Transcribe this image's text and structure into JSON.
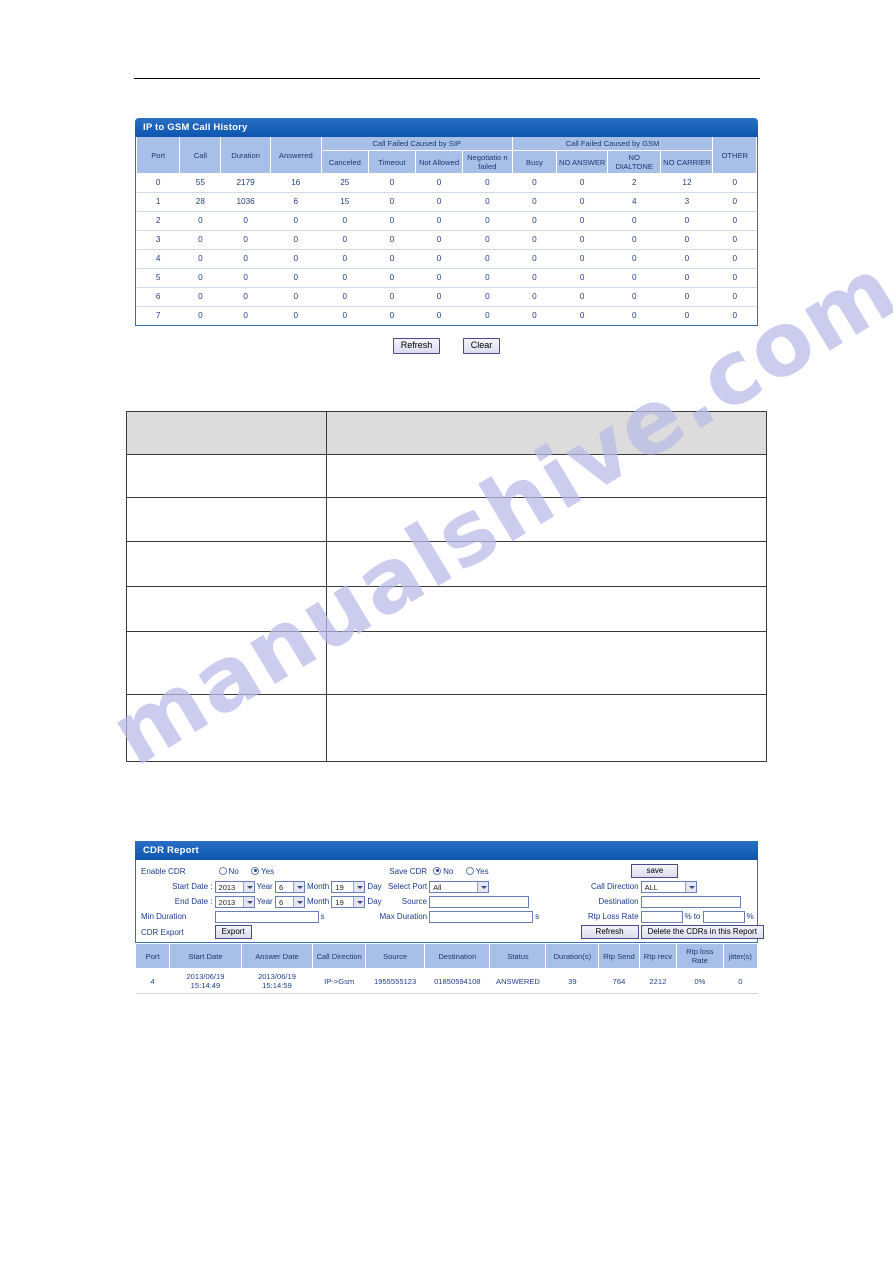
{
  "watermark": {
    "text": "manualshive.com"
  },
  "call_history": {
    "title": "IP to GSM Call History",
    "group_headers": {
      "sip": "Call Failed Caused by SIP",
      "gsm": "Call Failed Caused by GSM"
    },
    "columns": [
      "Port",
      "Call",
      "Duration",
      "Answered",
      "Canceled",
      "Timeout",
      "Not Allowed",
      "Negotiatio n failed",
      "Busy",
      "NO ANSWER",
      "NO DIALTONE",
      "NO CARRIER",
      "OTHER"
    ],
    "rows": [
      [
        "0",
        "55",
        "2179",
        "16",
        "25",
        "0",
        "0",
        "0",
        "0",
        "0",
        "2",
        "12",
        "0"
      ],
      [
        "1",
        "28",
        "1036",
        "6",
        "15",
        "0",
        "0",
        "0",
        "0",
        "0",
        "4",
        "3",
        "0"
      ],
      [
        "2",
        "0",
        "0",
        "0",
        "0",
        "0",
        "0",
        "0",
        "0",
        "0",
        "0",
        "0",
        "0"
      ],
      [
        "3",
        "0",
        "0",
        "0",
        "0",
        "0",
        "0",
        "0",
        "0",
        "0",
        "0",
        "0",
        "0"
      ],
      [
        "4",
        "0",
        "0",
        "0",
        "0",
        "0",
        "0",
        "0",
        "0",
        "0",
        "0",
        "0",
        "0"
      ],
      [
        "5",
        "0",
        "0",
        "0",
        "0",
        "0",
        "0",
        "0",
        "0",
        "0",
        "0",
        "0",
        "0"
      ],
      [
        "6",
        "0",
        "0",
        "0",
        "0",
        "0",
        "0",
        "0",
        "0",
        "0",
        "0",
        "0",
        "0"
      ],
      [
        "7",
        "0",
        "0",
        "0",
        "0",
        "0",
        "0",
        "0",
        "0",
        "0",
        "0",
        "0",
        "0"
      ]
    ],
    "buttons": {
      "refresh": "Refresh",
      "clear": "Clear"
    }
  },
  "spec_table": {
    "header": [
      "",
      ""
    ],
    "rows": [
      [
        "",
        ""
      ],
      [
        "",
        ""
      ],
      [
        "",
        ""
      ],
      [
        "",
        ""
      ],
      [
        "",
        ""
      ],
      [
        "",
        ""
      ]
    ]
  },
  "cdr_report": {
    "title": "CDR Report",
    "form": {
      "enable_cdr": {
        "label": "Enable CDR",
        "no": "No",
        "yes": "Yes",
        "selected": "Yes"
      },
      "save_cdr": {
        "label": "Save CDR",
        "no": "No",
        "yes": "Yes",
        "selected": "No"
      },
      "save_button": "save",
      "start_date": {
        "label": "Start Date :",
        "year": "2013",
        "year_unit": "Year",
        "month": "6",
        "month_unit": "Month",
        "day": "19",
        "day_unit": "Day"
      },
      "end_date": {
        "label": "End Date :",
        "year": "2013",
        "year_unit": "Year",
        "month": "6",
        "month_unit": "Month",
        "day": "19",
        "day_unit": "Day"
      },
      "select_port": {
        "label": "Select Port",
        "value": "All"
      },
      "call_direction": {
        "label": "Call Direction",
        "value": "ALL"
      },
      "source": {
        "label": "Source",
        "value": ""
      },
      "destination": {
        "label": "Destination",
        "value": ""
      },
      "min_duration": {
        "label": "Min Duration",
        "value": "",
        "unit": "s"
      },
      "max_duration": {
        "label": "Max Duration",
        "value": "",
        "unit": "s"
      },
      "rtp_loss_rate": {
        "label": "Rtp Loss Rate",
        "from": "",
        "to": "",
        "pct": "%",
        "to_word": "to",
        "pct2": "%"
      },
      "cdr_export": {
        "label": "CDR Export",
        "button": "Export"
      },
      "refresh_button": "Refresh",
      "delete_button": "Delete the CDRs in this Report"
    },
    "table": {
      "columns": [
        "Port",
        "Start Date",
        "Answer Date",
        "Call Direction",
        "Source",
        "Destination",
        "Status",
        "Duration(s)",
        "Rtp Send",
        "Rtp recv",
        "Rtp loss Rate",
        "jitter(s)"
      ],
      "rows": [
        {
          "port": "4",
          "start_date": "2013/06/19 15:14:49",
          "answer_date": "2013/06/19 15:14:59",
          "call_direction": "IP-&gt;Gsm",
          "source": "1955555123",
          "destination": "01850594108",
          "status": "ANSWERED",
          "duration": "39",
          "rtp_send": "764",
          "rtp_recv": "2212",
          "rtp_loss_rate": "0%",
          "jitter": "0"
        }
      ]
    }
  }
}
